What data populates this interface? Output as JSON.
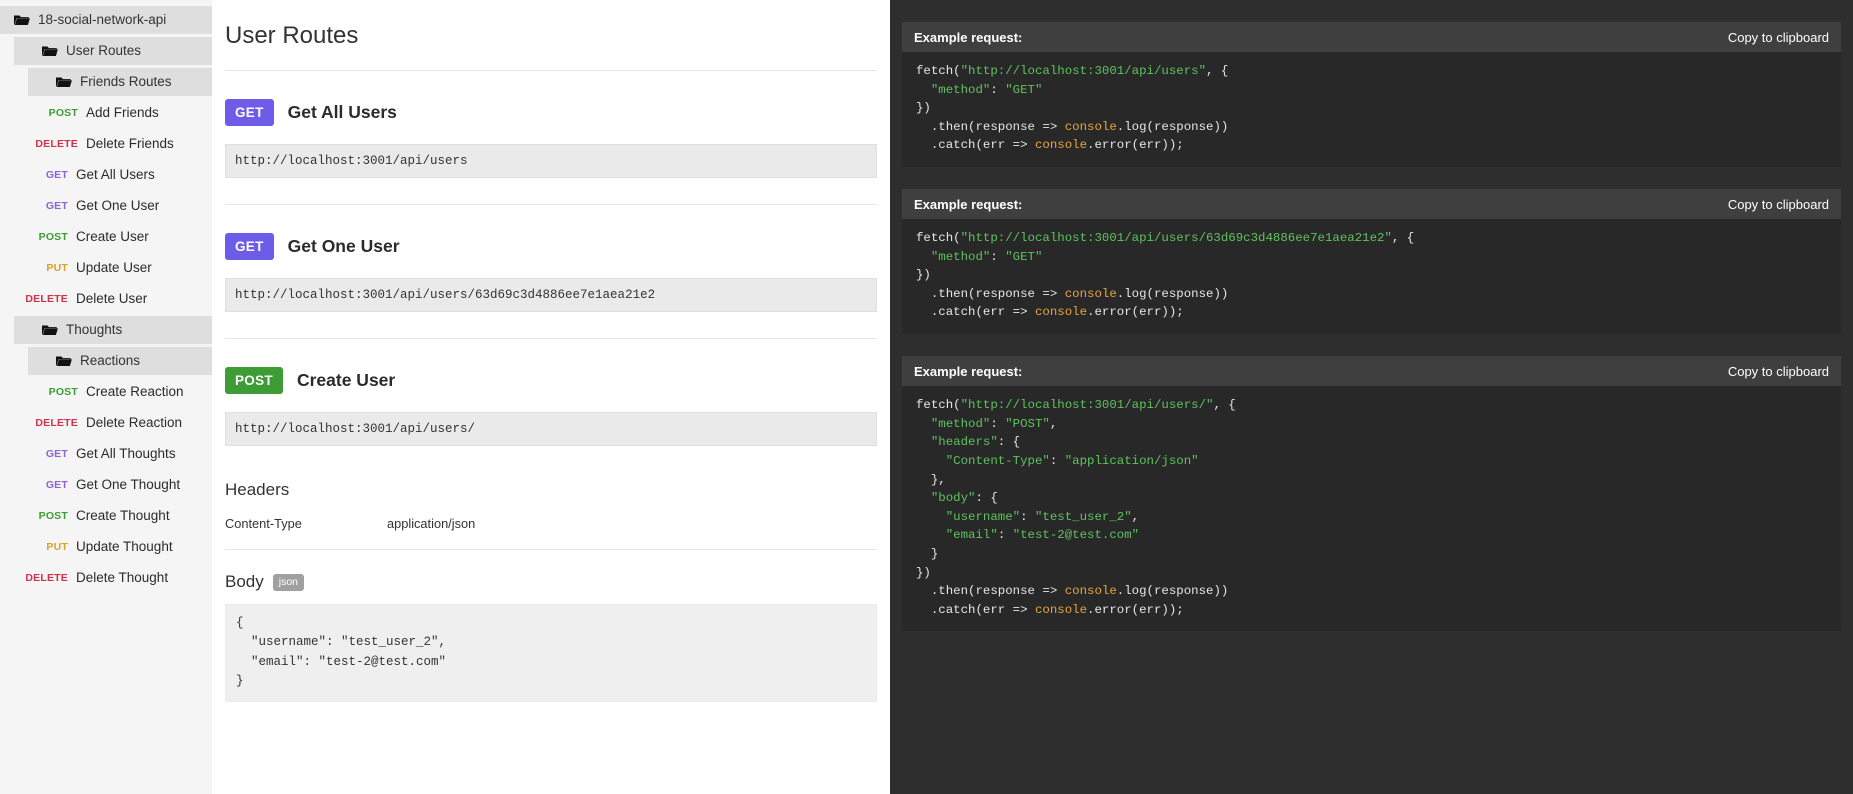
{
  "sidebar": {
    "items": [
      {
        "type": "folder",
        "level": 0,
        "label": "18-social-network-api",
        "icon": "folder-icon"
      },
      {
        "type": "folder",
        "level": 1,
        "label": "User Routes",
        "icon": "folder-icon"
      },
      {
        "type": "folder",
        "level": 2,
        "label": "Friends Routes",
        "icon": "folder-icon"
      },
      {
        "type": "route",
        "indent": 1,
        "method": "POST",
        "label": "Add Friends"
      },
      {
        "type": "route",
        "indent": 1,
        "method": "DELETE",
        "label": "Delete Friends"
      },
      {
        "type": "route",
        "indent": 0,
        "method": "GET",
        "label": "Get All Users"
      },
      {
        "type": "route",
        "indent": 0,
        "method": "GET",
        "label": "Get One User"
      },
      {
        "type": "route",
        "indent": 0,
        "method": "POST",
        "label": "Create User"
      },
      {
        "type": "route",
        "indent": 0,
        "method": "PUT",
        "label": "Update User"
      },
      {
        "type": "route",
        "indent": 0,
        "method": "DELETE",
        "label": "Delete User"
      },
      {
        "type": "folder",
        "level": 1,
        "label": "Thoughts",
        "icon": "folder-icon"
      },
      {
        "type": "folder",
        "level": 2,
        "label": "Reactions",
        "icon": "folder-icon"
      },
      {
        "type": "route",
        "indent": 1,
        "method": "POST",
        "label": "Create Reaction"
      },
      {
        "type": "route",
        "indent": 1,
        "method": "DELETE",
        "label": "Delete Reaction"
      },
      {
        "type": "route",
        "indent": 0,
        "method": "GET",
        "label": "Get All Thoughts"
      },
      {
        "type": "route",
        "indent": 0,
        "method": "GET",
        "label": "Get One Thought"
      },
      {
        "type": "route",
        "indent": 0,
        "method": "POST",
        "label": "Create Thought"
      },
      {
        "type": "route",
        "indent": 0,
        "method": "PUT",
        "label": "Update Thought"
      },
      {
        "type": "route",
        "indent": 0,
        "method": "DELETE",
        "label": "Delete Thought"
      }
    ]
  },
  "main": {
    "page_title": "User Routes",
    "routes": [
      {
        "method": "GET",
        "title": "Get All Users",
        "url": "http://localhost:3001/api/users"
      },
      {
        "method": "GET",
        "title": "Get One User",
        "url": "http://localhost:3001/api/users/63d69c3d4886ee7e1aea21e2"
      },
      {
        "method": "POST",
        "title": "Create User",
        "url": "http://localhost:3001/api/users/",
        "headers_title": "Headers",
        "headers": [
          {
            "key": "Content-Type",
            "value": "application/json"
          }
        ],
        "body_title": "Body",
        "body_tag": "json",
        "body": "{\n  \"username\": \"test_user_2\",\n  \"email\": \"test-2@test.com\"\n}"
      }
    ]
  },
  "code_panel": {
    "examples": [
      {
        "label": "Example request:",
        "copy_label": "Copy to clipboard",
        "lines": [
          [
            {
              "t": "pln",
              "v": "fetch("
            },
            {
              "t": "str",
              "v": "\"http://localhost:3001/api/users\""
            },
            {
              "t": "pln",
              "v": ", {"
            }
          ],
          [
            {
              "t": "pln",
              "v": "  "
            },
            {
              "t": "str",
              "v": "\"method\""
            },
            {
              "t": "pln",
              "v": ": "
            },
            {
              "t": "str",
              "v": "\"GET\""
            }
          ],
          [
            {
              "t": "pln",
              "v": "})"
            }
          ],
          [
            {
              "t": "pln",
              "v": "  .then(response => "
            },
            {
              "t": "obj",
              "v": "console"
            },
            {
              "t": "pln",
              "v": ".log(response))"
            }
          ],
          [
            {
              "t": "pln",
              "v": "  .catch(err => "
            },
            {
              "t": "obj",
              "v": "console"
            },
            {
              "t": "pln",
              "v": ".error(err));"
            }
          ]
        ]
      },
      {
        "label": "Example request:",
        "copy_label": "Copy to clipboard",
        "lines": [
          [
            {
              "t": "pln",
              "v": "fetch("
            },
            {
              "t": "str",
              "v": "\"http://localhost:3001/api/users/63d69c3d4886ee7e1aea21e2\""
            },
            {
              "t": "pln",
              "v": ", {"
            }
          ],
          [
            {
              "t": "pln",
              "v": "  "
            },
            {
              "t": "str",
              "v": "\"method\""
            },
            {
              "t": "pln",
              "v": ": "
            },
            {
              "t": "str",
              "v": "\"GET\""
            }
          ],
          [
            {
              "t": "pln",
              "v": "})"
            }
          ],
          [
            {
              "t": "pln",
              "v": "  .then(response => "
            },
            {
              "t": "obj",
              "v": "console"
            },
            {
              "t": "pln",
              "v": ".log(response))"
            }
          ],
          [
            {
              "t": "pln",
              "v": "  .catch(err => "
            },
            {
              "t": "obj",
              "v": "console"
            },
            {
              "t": "pln",
              "v": ".error(err));"
            }
          ]
        ]
      },
      {
        "label": "Example request:",
        "copy_label": "Copy to clipboard",
        "lines": [
          [
            {
              "t": "pln",
              "v": "fetch("
            },
            {
              "t": "str",
              "v": "\"http://localhost:3001/api/users/\""
            },
            {
              "t": "pln",
              "v": ", {"
            }
          ],
          [
            {
              "t": "pln",
              "v": "  "
            },
            {
              "t": "str",
              "v": "\"method\""
            },
            {
              "t": "pln",
              "v": ": "
            },
            {
              "t": "str",
              "v": "\"POST\""
            },
            {
              "t": "pln",
              "v": ","
            }
          ],
          [
            {
              "t": "pln",
              "v": "  "
            },
            {
              "t": "str",
              "v": "\"headers\""
            },
            {
              "t": "pln",
              "v": ": {"
            }
          ],
          [
            {
              "t": "pln",
              "v": "    "
            },
            {
              "t": "str",
              "v": "\"Content-Type\""
            },
            {
              "t": "pln",
              "v": ": "
            },
            {
              "t": "str",
              "v": "\"application/json\""
            }
          ],
          [
            {
              "t": "pln",
              "v": "  },"
            }
          ],
          [
            {
              "t": "pln",
              "v": "  "
            },
            {
              "t": "str",
              "v": "\"body\""
            },
            {
              "t": "pln",
              "v": ": {"
            }
          ],
          [
            {
              "t": "pln",
              "v": "    "
            },
            {
              "t": "str",
              "v": "\"username\""
            },
            {
              "t": "pln",
              "v": ": "
            },
            {
              "t": "str",
              "v": "\"test_user_2\""
            },
            {
              "t": "pln",
              "v": ","
            }
          ],
          [
            {
              "t": "pln",
              "v": "    "
            },
            {
              "t": "str",
              "v": "\"email\""
            },
            {
              "t": "pln",
              "v": ": "
            },
            {
              "t": "str",
              "v": "\"test-2@test.com\""
            }
          ],
          [
            {
              "t": "pln",
              "v": "  }"
            }
          ],
          [
            {
              "t": "pln",
              "v": "})"
            }
          ],
          [
            {
              "t": "pln",
              "v": "  .then(response => "
            },
            {
              "t": "obj",
              "v": "console"
            },
            {
              "t": "pln",
              "v": ".log(response))"
            }
          ],
          [
            {
              "t": "pln",
              "v": "  .catch(err => "
            },
            {
              "t": "obj",
              "v": "console"
            },
            {
              "t": "pln",
              "v": ".error(err));"
            }
          ]
        ]
      }
    ]
  },
  "colors": {
    "get": "#6c5ce7",
    "post": "#3d9c35",
    "put": "#d8a128",
    "delete": "#d0324b",
    "code_string": "#5ec25e",
    "code_object": "#e8a33d",
    "dark_bg": "#2e2e2e",
    "code_bg": "#282828"
  }
}
